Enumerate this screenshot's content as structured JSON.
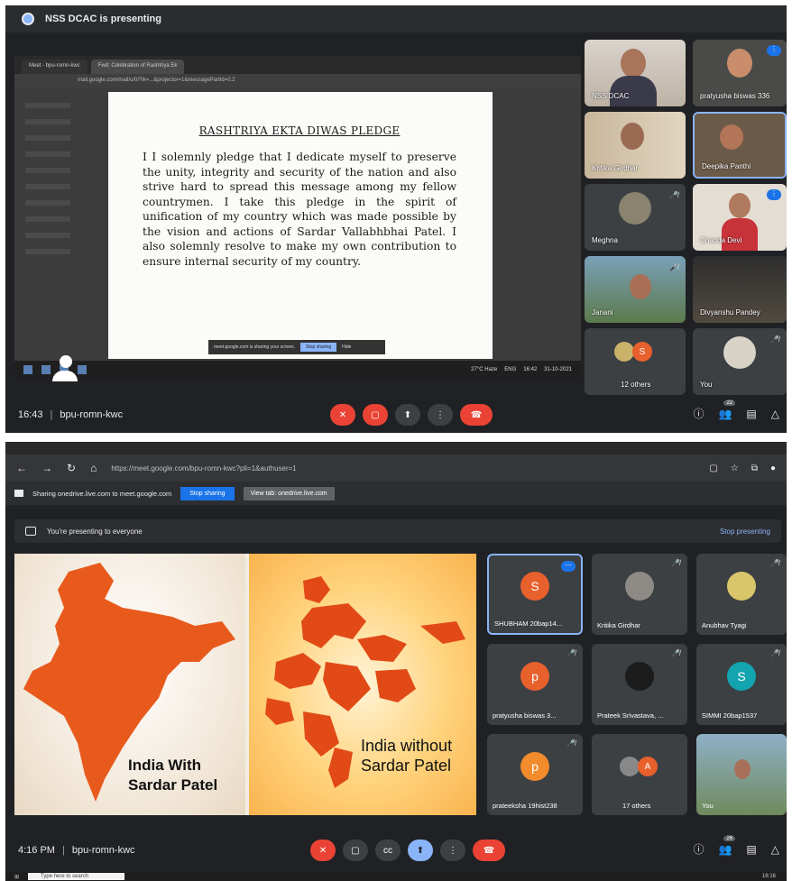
{
  "top": {
    "presenting_banner": "NSS DCAC is presenting",
    "browser_tabs": [
      "Meet - bpu-romn-kwc",
      "Fwd: Celebration of Rashtriya Ek"
    ],
    "browser_url": "mail.google.com/mail/u/0/?ik=...&projector=1&messagePartId=0.2",
    "document": {
      "title": "RASHTRIYA EKTA DIWAS PLEDGE",
      "body": "I I solemnly pledge that I dedicate myself to preserve the unity, integrity and security of the nation and also strive hard to spread this message among my fellow countrymen. I take this pledge in the spirit of unification of my country which was made possible by the vision and actions of Sardar Vallabhbhai Patel. I also solemnly resolve to make my own contribution to ensure internal security of my country."
    },
    "share_notice": {
      "text": "meet.google.com is sharing your screen.",
      "stop": "Stop sharing",
      "hide": "Hide"
    },
    "taskbar": {
      "weather": "27°C Haze",
      "lang": "ENG",
      "time": "16:42",
      "date": "31-10-2021"
    },
    "participants": [
      {
        "name": "NSS DCAC"
      },
      {
        "name": "pratyusha biswas 336"
      },
      {
        "name": "Kritika Girdhar"
      },
      {
        "name": "Deepika Panthi"
      },
      {
        "name": "Meghna"
      },
      {
        "name": "Chanda Devi"
      },
      {
        "name": "Janani"
      },
      {
        "name": "Divyanshu Pandey"
      },
      {
        "name": "12 others",
        "initial": "S"
      },
      {
        "name": "You"
      }
    ],
    "bar": {
      "time": "16:43",
      "meeting_code": "bpu-romn-kwc",
      "people_count": "22"
    }
  },
  "bottom": {
    "browser_url": "https://meet.google.com/bpu-romn-kwc?pli=1&authuser=1",
    "share_bar": {
      "text": "Sharing onedrive.live.com to meet.google.com",
      "stop": "Stop sharing",
      "view": "View tab: onedrive.live.com"
    },
    "present_bar": {
      "text": "You're presenting to everyone",
      "stop": "Stop presenting"
    },
    "slide": {
      "left_caption": "India With\nSardar Patel",
      "right_caption": "India without\nSardar Patel"
    },
    "participants": [
      {
        "name": "SHUBHAM 20bap14...",
        "initial": "S",
        "color": "#e8602c"
      },
      {
        "name": "Kritika Girdhar"
      },
      {
        "name": "Anubhav Tyagi"
      },
      {
        "name": "pratyusha biswas 3...",
        "initial": "p",
        "color": "#e8602c"
      },
      {
        "name": "Prateek Srivastava, ..."
      },
      {
        "name": "SIMMI 20bap1537",
        "initial": "S",
        "color": "#12a4af"
      },
      {
        "name": "prateeksha 19hist238",
        "initial": "p",
        "color": "#f28b2c"
      },
      {
        "name": "17 others",
        "initial": "A"
      },
      {
        "name": "You"
      }
    ],
    "bar": {
      "time": "4:16 PM",
      "meeting_code": "bpu-romn-kwc",
      "people_count": "26"
    },
    "win_search": "Type here to search",
    "win_time": "16:16"
  }
}
